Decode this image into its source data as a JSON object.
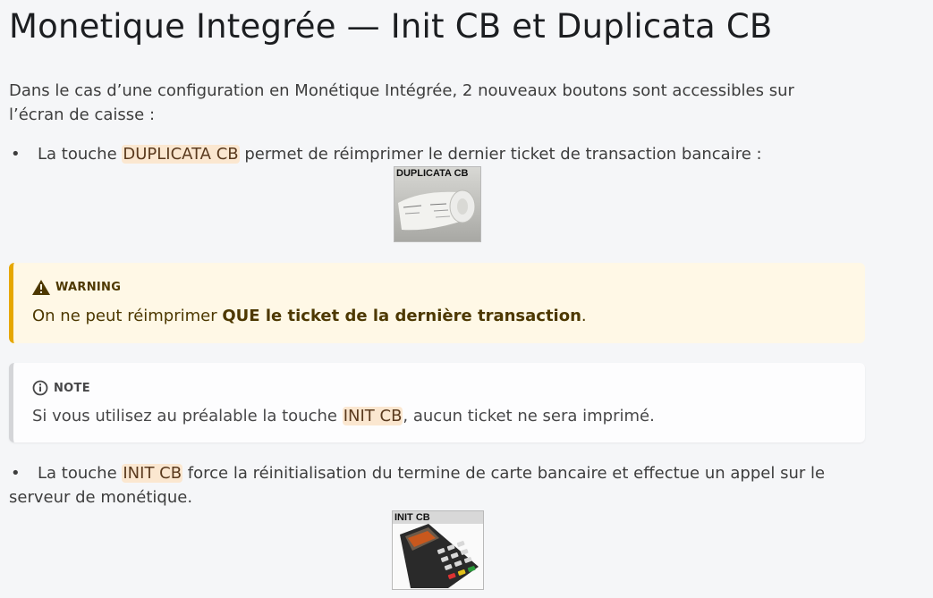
{
  "title": "Monetique Integrée — Init CB et Duplicata CB",
  "intro": "Dans le cas d’une configuration en Monétique Intégrée, 2 nouveaux boutons sont accessibles sur l’écran de caisse :",
  "bullet1": {
    "prefix": "La touche ",
    "code": "DUPLICATA CB",
    "suffix": " permet de réimprimer le dernier ticket de transaction bancaire :",
    "image_label": "DUPLICATA CB"
  },
  "warning": {
    "label": "WARNING",
    "text_prefix": "On ne peut réimprimer ",
    "text_bold": "QUE le ticket de la dernière transaction",
    "text_suffix": ".",
    "icon": "warning-triangle-icon",
    "accent": "#e6a700"
  },
  "note": {
    "label": "NOTE",
    "text_prefix": "Si vous utilisez au préalable la touche ",
    "code": "INIT CB",
    "text_suffix": ", aucun ticket ne sera imprimé.",
    "icon": "info-circle-icon"
  },
  "bullet2": {
    "prefix": "La touche ",
    "code": "INIT CB",
    "suffix": " force la réinitialisation du termine de carte bancaire et effectue un appel sur le serveur de monétique.",
    "image_label": "INIT CB"
  }
}
